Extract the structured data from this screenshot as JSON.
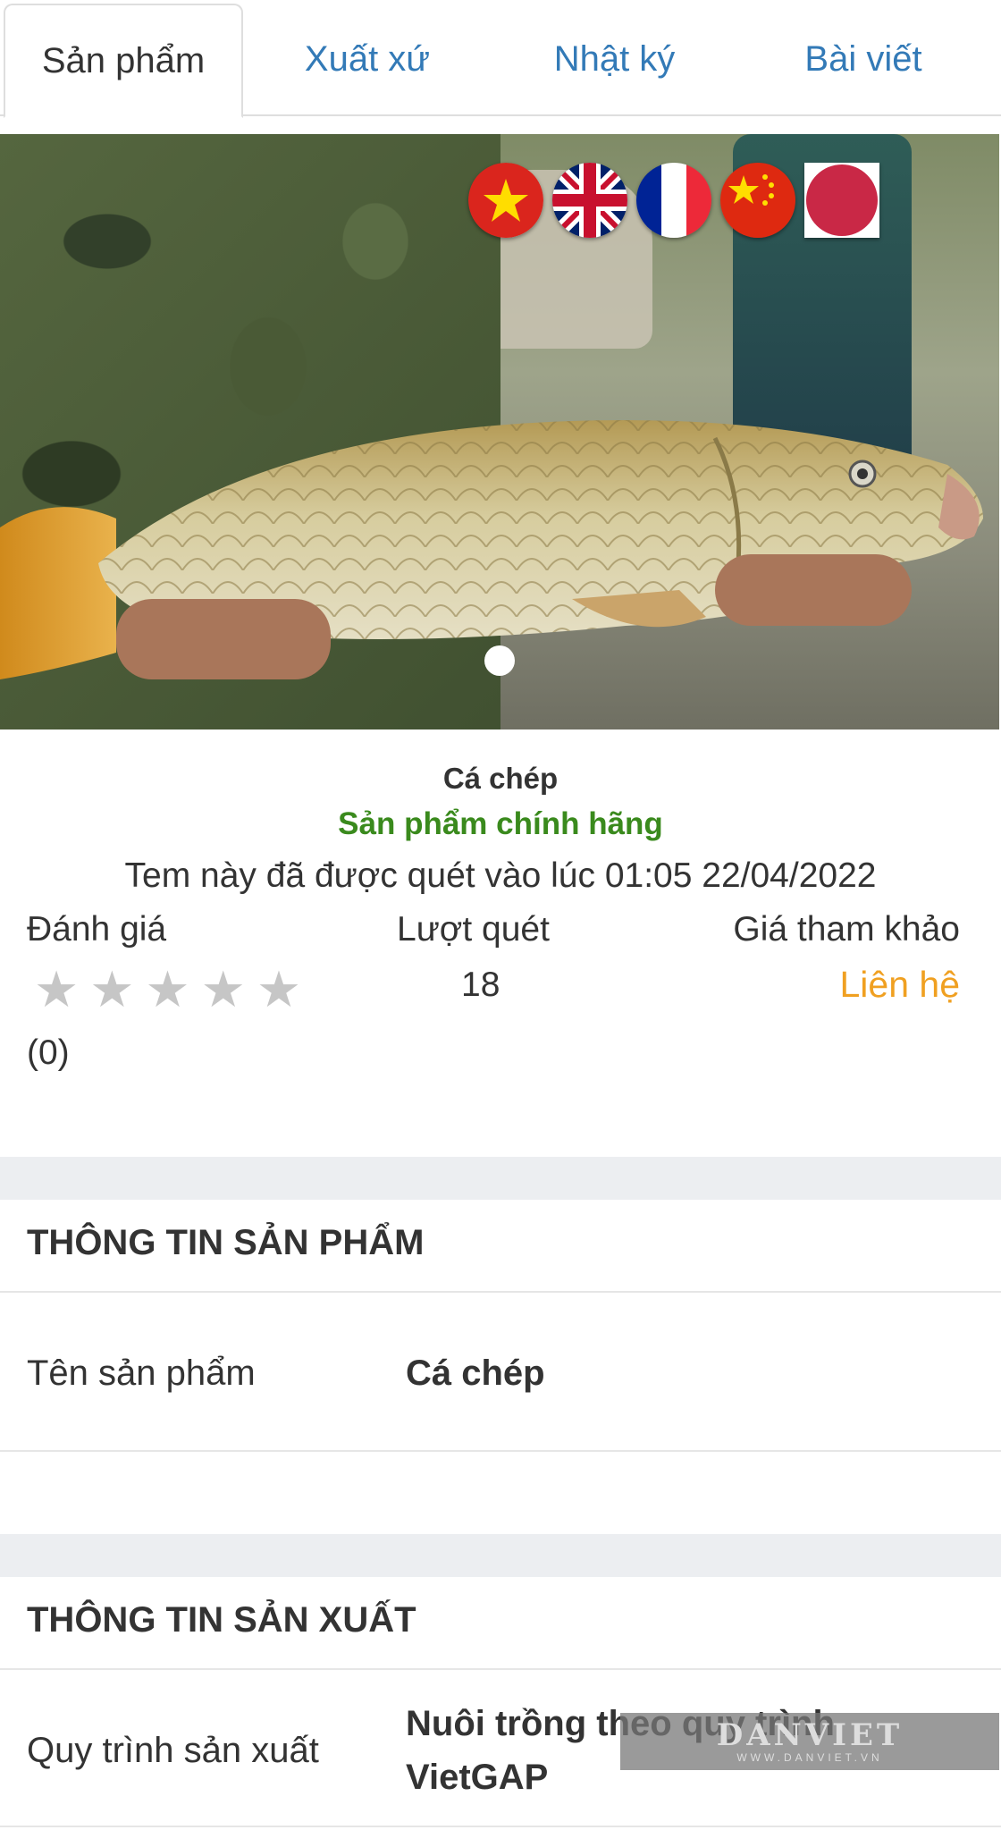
{
  "tabs": [
    {
      "label": "Sản phẩm",
      "active": true
    },
    {
      "label": "Xuất xứ",
      "active": false
    },
    {
      "label": "Nhật ký",
      "active": false
    },
    {
      "label": "Bài viết",
      "active": false
    }
  ],
  "language_flags": [
    {
      "name": "vietnam-flag-icon"
    },
    {
      "name": "uk-flag-icon"
    },
    {
      "name": "france-flag-icon"
    },
    {
      "name": "china-flag-icon"
    },
    {
      "name": "japan-flag-icon"
    }
  ],
  "carousel": {
    "slide_count": 1,
    "current": 1
  },
  "product": {
    "name": "Cá chép",
    "authenticity": "Sản phẩm chính hãng",
    "scan_notice": "Tem này đã được quét vào lúc 01:05 22/04/2022",
    "rating_label": "Đánh giá",
    "rating_value": 0,
    "rating_max": 5,
    "rating_count": "(0)",
    "scans_label": "Lượt quét",
    "scans_value": "18",
    "price_label": "Giá tham khảo",
    "price_value": "Liên hệ"
  },
  "product_info": {
    "title": "THÔNG TIN SẢN PHẨM",
    "rows": [
      {
        "label": "Tên sản phẩm",
        "value": "Cá chép"
      }
    ]
  },
  "production_info": {
    "title": "THÔNG TIN SẢN XUẤT",
    "rows": [
      {
        "label": "Quy trình sản xuất",
        "value_line1": "Nuôi trồng theo quy trình",
        "value_line2": "VietGAP"
      }
    ]
  },
  "watermark": {
    "brand": "DANVIET",
    "url": "WWW.DANVIET.VN"
  },
  "colors": {
    "tab_link": "#337ab7",
    "genuine": "#3a8a1d",
    "price": "#f0a021",
    "section_gap": "#eceef1"
  }
}
